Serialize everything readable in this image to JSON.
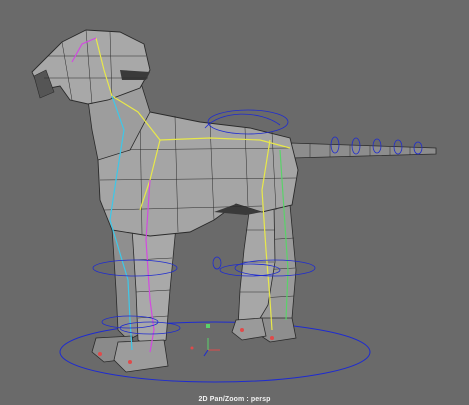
{
  "viewport": {
    "camera": "persp",
    "hud_label": "2D Pan/Zoom : persp"
  },
  "scene": {
    "model": "dog-rig",
    "display": "wireframe-on-shaded"
  },
  "colors": {
    "background": "#6a6a6a",
    "mesh_fill": "#9b9b9b",
    "mesh_shadow": "#5a5a5a",
    "wire": "#2a2a2a",
    "control_curve": "#1e2bd0",
    "joint_yellow": "#e8e84a",
    "joint_cyan": "#3ec7e8",
    "joint_magenta": "#d24ae0",
    "joint_green": "#5ad26a",
    "joint_red": "#e04a4a"
  }
}
